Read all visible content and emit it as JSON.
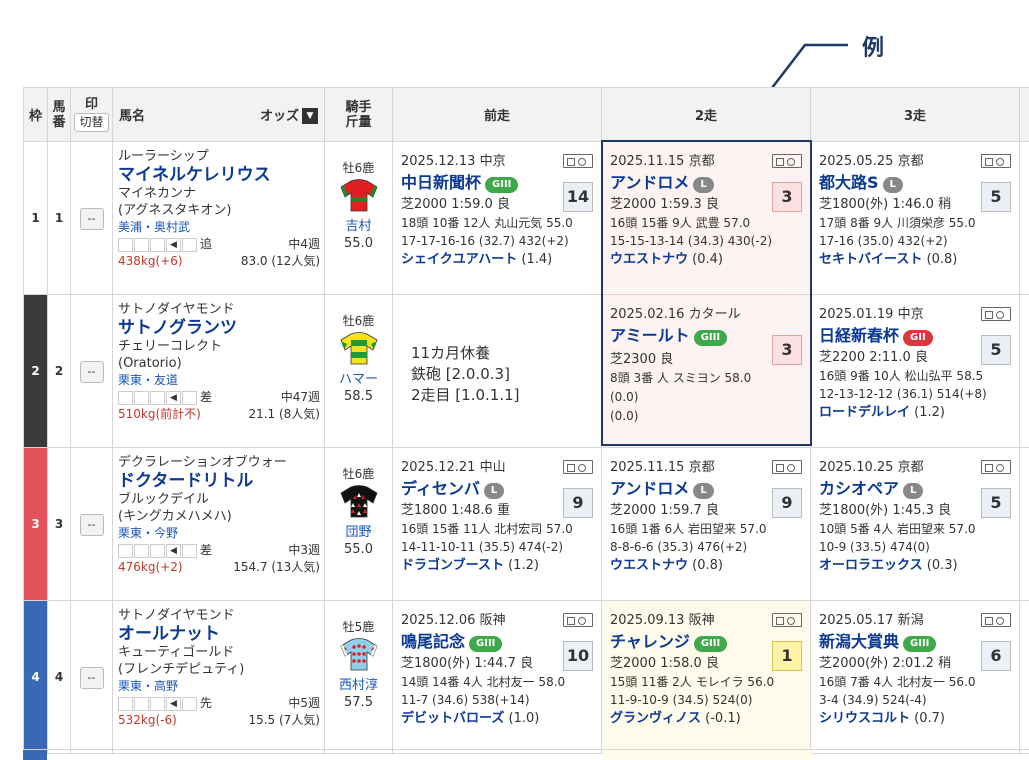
{
  "callout": {
    "label": "例"
  },
  "header": {
    "waku": "枠",
    "umaban_line1": "馬",
    "umaban_line2": "番",
    "mark_line1": "印",
    "mark_toggle": "切替",
    "horse_name": "馬名",
    "odds": "オッズ",
    "sort_icon": "▼",
    "jockey_line1": "騎手",
    "jockey_line2": "斤量",
    "prev1": "前走",
    "prev2": "2走",
    "prev3": "3走"
  },
  "colors": {
    "waku1": "#ffffff",
    "waku2": "#3a3a3a",
    "waku3": "#e3525a",
    "waku4": "#3a67b6",
    "link": "#0b3a94",
    "callout": "#1f3864"
  },
  "horses": [
    {
      "waku": "1",
      "umaban": "1",
      "mark": "--",
      "sire": "ルーラーシップ",
      "name": "マイネルケレリウス",
      "dam": "マイネカンナ",
      "damsire": "(アグネスタキオン)",
      "trainer": "美浦・奥村武",
      "kyakusitu": "追",
      "interval": "中4週",
      "weight": "438kg(+6)",
      "odds": "83.0 (12人気)",
      "sexage": "牡6鹿",
      "jockey": "吉村",
      "kinryo": "55.0",
      "past": [
        {
          "date": "2025.12.13 中京",
          "race": "中日新聞杯",
          "grade": "GIII",
          "cond": "芝2000 1:59.0 良",
          "line1": "18頭 10番 12人 丸山元気 55.0",
          "line2": "17-17-16-16 (32.7) 432(+2)",
          "winner": "シェイクユアハート",
          "margin": "(1.4)",
          "rank": "14"
        },
        {
          "date": "2025.11.15 京都",
          "race": "アンドロメ",
          "grade": "L",
          "cond": "芝2000 1:59.3 良",
          "line1": "16頭 15番 9人 武豊 57.0",
          "line2": "15-15-13-14 (34.3) 430(-2)",
          "winner": "ウエストナウ",
          "margin": "(0.4)",
          "rank": "3"
        },
        {
          "date": "2025.05.25 京都",
          "race": "都大路S",
          "grade": "L",
          "cond": "芝1800(外) 1:46.0 稍",
          "line1": "17頭 8番 9人 川須栄彦 55.0",
          "line2": "17-16 (35.0) 432(+2)",
          "winner": "セキトバイースト",
          "margin": "(0.8)",
          "rank": "5"
        }
      ]
    },
    {
      "waku": "2",
      "umaban": "2",
      "mark": "--",
      "sire": "サトノダイヤモンド",
      "name": "サトノグランツ",
      "dam": "チェリーコレクト",
      "damsire": "(Oratorio)",
      "trainer": "栗東・友道",
      "kyakusitu": "差",
      "interval": "中47週",
      "weight": "510kg(前計不)",
      "odds": "21.1 (8人気)",
      "sexage": "牡6鹿",
      "jockey": "ハマー",
      "kinryo": "58.5",
      "rest": {
        "line1": "11カ月休養",
        "line2": "鉄砲 [2.0.0.3]",
        "line3": "2走目 [1.0.1.1]"
      },
      "past": [
        {
          "date": "2025.02.16 カタール",
          "race": "アミールト",
          "grade": "GIII",
          "cond": "芝2300 良",
          "line1": "8頭 3番 人 スミヨン 58.0",
          "line2": "(0.0)",
          "line3": "(0.0)",
          "rank": "3"
        },
        {
          "date": "2025.01.19 中京",
          "race": "日経新春杯",
          "grade": "GII",
          "cond": "芝2200 2:11.0 良",
          "line1": "16頭 9番 10人 松山弘平 58.5",
          "line2": "12-13-12-12 (36.1) 514(+8)",
          "winner": "ロードデルレイ",
          "margin": "(1.2)",
          "rank": "5"
        }
      ]
    },
    {
      "waku": "3",
      "umaban": "3",
      "mark": "--",
      "sire": "デクラレーションオブウォー",
      "name": "ドクタードリトル",
      "dam": "ブルックデイル",
      "damsire": "(キングカメハメハ)",
      "trainer": "栗東・今野",
      "kyakusitu": "差",
      "interval": "中3週",
      "weight": "476kg(+2)",
      "odds": "154.7 (13人気)",
      "sexage": "牡6鹿",
      "jockey": "団野",
      "kinryo": "55.0",
      "past": [
        {
          "date": "2025.12.21 中山",
          "race": "ディセンバ",
          "grade": "L",
          "cond": "芝1800 1:48.6 重",
          "line1": "16頭 15番 11人 北村宏司 57.0",
          "line2": "14-11-10-11 (35.5) 474(-2)",
          "winner": "ドラゴンブースト",
          "margin": "(1.2)",
          "rank": "9"
        },
        {
          "date": "2025.11.15 京都",
          "race": "アンドロメ",
          "grade": "L",
          "cond": "芝2000 1:59.7 良",
          "line1": "16頭 1番 6人 岩田望来 57.0",
          "line2": "8-8-6-6 (35.3) 476(+2)",
          "winner": "ウエストナウ",
          "margin": "(0.8)",
          "rank": "9"
        },
        {
          "date": "2025.10.25 京都",
          "race": "カシオペア",
          "grade": "L",
          "cond": "芝1800(外) 1:45.3 良",
          "line1": "10頭 5番 4人 岩田望来 57.0",
          "line2": "10-9 (33.5) 474(0)",
          "winner": "オーロラエックス",
          "margin": "(0.3)",
          "rank": "5"
        }
      ]
    },
    {
      "waku": "4",
      "umaban": "4",
      "mark": "--",
      "sire": "サトノダイヤモンド",
      "name": "オールナット",
      "dam": "キューティゴールド",
      "damsire": "(フレンチデピュティ)",
      "trainer": "栗東・高野",
      "kyakusitu": "先",
      "interval": "中5週",
      "weight": "532kg(-6)",
      "odds": "15.5 (7人気)",
      "sexage": "牡5鹿",
      "jockey": "西村淳",
      "kinryo": "57.5",
      "past": [
        {
          "date": "2025.12.06 阪神",
          "race": "鳴尾記念",
          "grade": "GIII",
          "cond": "芝1800(外) 1:44.7 良",
          "line1": "14頭 14番 4人 北村友一 58.0",
          "line2": "11-7 (34.6) 538(+14)",
          "winner": "デビットバローズ",
          "margin": "(1.0)",
          "rank": "10"
        },
        {
          "date": "2025.09.13 阪神",
          "race": "チャレンジ",
          "grade": "GIII",
          "cond": "芝2000 1:58.0 良",
          "line1": "15頭 11番 2人 モレイラ 56.0",
          "line2": "11-9-10-9 (34.5) 524(0)",
          "winner": "グランヴィノス",
          "margin": "(-0.1)",
          "rank": "1"
        },
        {
          "date": "2025.05.17 新潟",
          "race": "新潟大賞典",
          "grade": "GIII",
          "cond": "芝2000(外) 2:01.2 稍",
          "line1": "16頭 7番 4人 北村友一 56.0",
          "line2": "3-4 (34.9) 524(-4)",
          "winner": "シリウスコルト",
          "margin": "(0.7)",
          "rank": "6"
        }
      ]
    }
  ]
}
